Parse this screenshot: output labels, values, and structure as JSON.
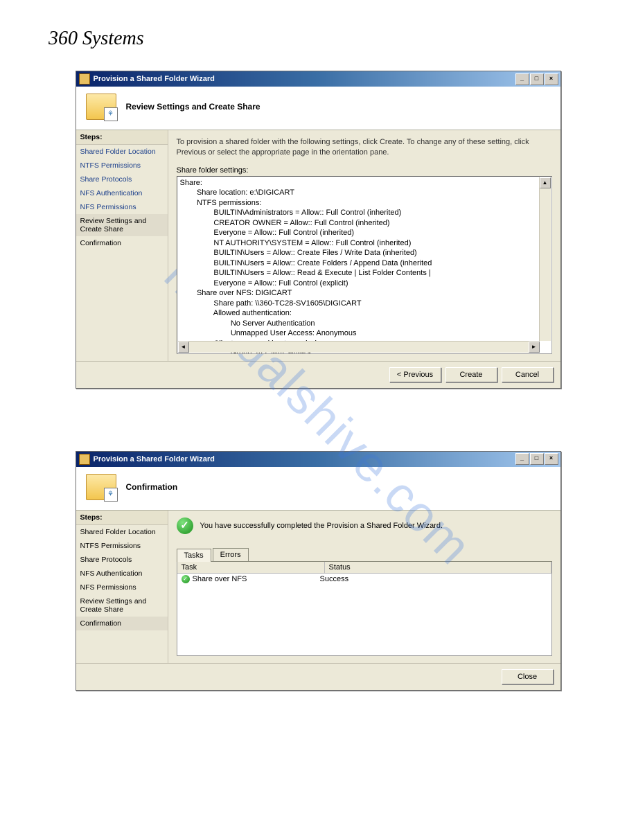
{
  "logo_text": "360 Systems",
  "watermark": "manualshive.com",
  "window1": {
    "title": "Provision a Shared Folder Wizard",
    "header": "Review Settings and Create Share",
    "steps_label": "Steps:",
    "steps": [
      {
        "label": "Shared Folder Location",
        "link": true
      },
      {
        "label": "NTFS Permissions",
        "link": true
      },
      {
        "label": "Share Protocols",
        "link": true
      },
      {
        "label": "NFS Authentication",
        "link": true
      },
      {
        "label": "NFS Permissions",
        "link": true
      },
      {
        "label": "Review Settings and Create Share",
        "selected": true
      },
      {
        "label": "Confirmation",
        "plain": true
      }
    ],
    "instruction": "To provision a shared folder with the following settings, click Create. To change any of these setting, click Previous or select the appropriate page in the orientation pane.",
    "settings_label": "Share folder settings:",
    "settings_text": "Share:\n        Share location: e:\\DIGICART\n        NTFS permissions:\n                BUILTIN\\Administrators = Allow:: Full Control (inherited)\n                CREATOR OWNER = Allow:: Full Control (inherited)\n                Everyone = Allow:: Full Control (inherited)\n                NT AUTHORITY\\SYSTEM = Allow:: Full Control (inherited)\n                BUILTIN\\Users = Allow:: Create Files / Write Data (inherited)\n                BUILTIN\\Users = Allow:: Create Folders / Append Data (inherited\n                BUILTIN\\Users = Allow:: Read & Execute | List Folder Contents |\n                Everyone = Allow:: Full Control (explicit)\n        Share over NFS: DIGICART\n                Share path: \\\\360-TC28-SV1605\\DIGICART\n                Allowed authentication:\n                        No Server Authentication\n                        Unmapped User Access: Anonymous\n                Client group and host permissions:\n                        Group: ALL MACHINES\n                                Encoding: ANSI\n                                Access: Read-Write\n                                Root access: Allowed",
    "btn_previous": "< Previous",
    "btn_create": "Create",
    "btn_cancel": "Cancel"
  },
  "window2": {
    "title": "Provision a Shared Folder Wizard",
    "header": "Confirmation",
    "steps_label": "Steps:",
    "steps": [
      {
        "label": "Shared Folder Location",
        "plain": true
      },
      {
        "label": "NTFS Permissions",
        "plain": true
      },
      {
        "label": "Share Protocols",
        "plain": true
      },
      {
        "label": "NFS Authentication",
        "plain": true
      },
      {
        "label": "NFS Permissions",
        "plain": true
      },
      {
        "label": "Review Settings and Create Share",
        "plain": true
      },
      {
        "label": "Confirmation",
        "selected": true
      }
    ],
    "success_msg": "You have successfully completed the Provision a Shared Folder Wizard.",
    "tab_tasks": "Tasks",
    "tab_errors": "Errors",
    "col_task": "Task",
    "col_status": "Status",
    "task_name": "Share over NFS",
    "task_status": "Success",
    "btn_close": "Close"
  }
}
